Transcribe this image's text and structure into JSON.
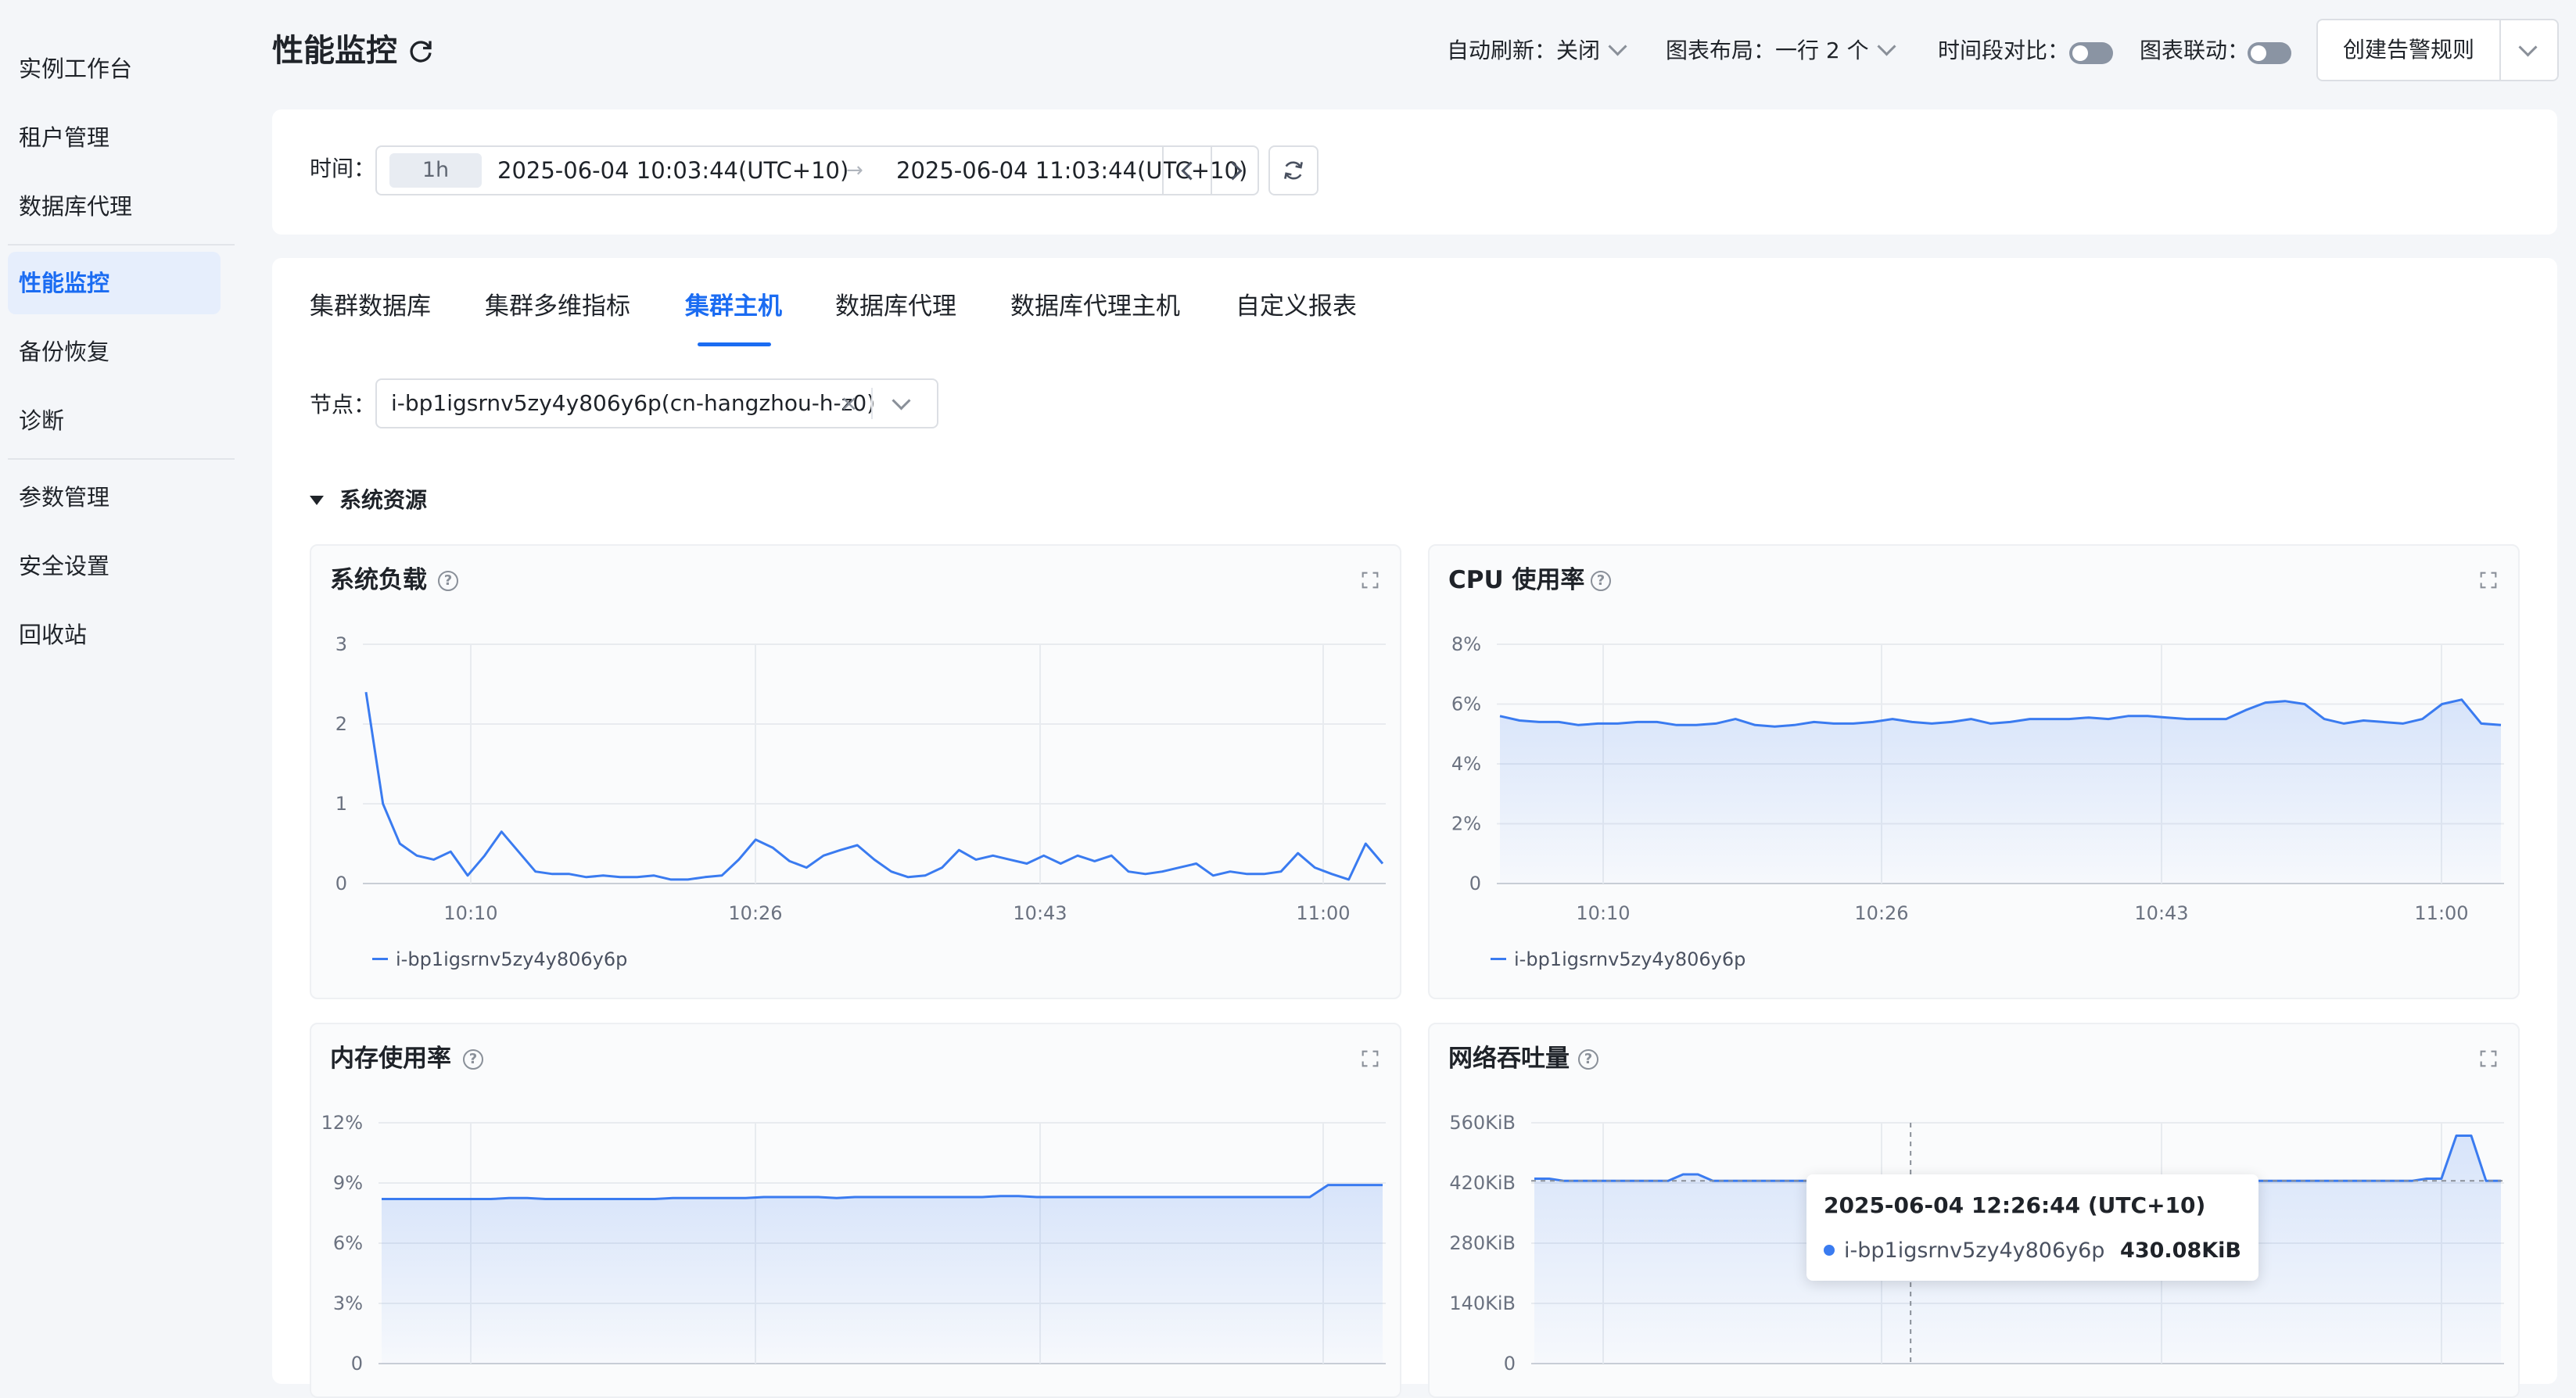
{
  "sidebar": {
    "items": [
      {
        "label": "实例工作台"
      },
      {
        "label": "租户管理"
      },
      {
        "label": "数据库代理"
      },
      {
        "label": "性能监控",
        "active": true
      },
      {
        "label": "备份恢复"
      },
      {
        "label": "诊断"
      },
      {
        "label": "参数管理"
      },
      {
        "label": "安全设置"
      },
      {
        "label": "回收站"
      }
    ]
  },
  "header": {
    "title": "性能监控",
    "auto_refresh": "自动刷新：关闭",
    "chart_layout": "图表布局：一行 2 个",
    "period_compare": "时间段对比：",
    "chart_link": "图表联动：",
    "create_alert": "创建告警规则"
  },
  "time": {
    "label": "时间：",
    "range": "1h",
    "start": "2025-06-04 10:03:44(UTC+10)",
    "arrow": "→",
    "end": "2025-06-04 11:03:44(UTC+10)"
  },
  "tabs": [
    {
      "label": "集群数据库"
    },
    {
      "label": "集群多维指标"
    },
    {
      "label": "集群主机",
      "active": true
    },
    {
      "label": "数据库代理"
    },
    {
      "label": "数据库代理主机"
    },
    {
      "label": "自定义报表"
    }
  ],
  "node": {
    "label": "节点：",
    "value": "i-bp1igsrnv5zy4y806y6p(cn-hangzhou-h-z0)",
    "remove": "×"
  },
  "section": {
    "title": "系统资源"
  },
  "colors": {
    "accent": "#1b6cf2",
    "series": "#3a7bf0"
  },
  "icons": {
    "help": "question-circle",
    "expand": "fullscreen",
    "refresh": "refresh"
  },
  "chart_data": [
    {
      "type": "line",
      "title": "系统负载",
      "help": "?",
      "yticks": [
        "3",
        "2",
        "1",
        "0"
      ],
      "ylim": [
        0,
        3
      ],
      "xticks": [
        "10:10",
        "10:26",
        "10:43",
        "11:00"
      ],
      "series": [
        {
          "name": "i-bp1igsrnv5zy4y806y6p",
          "values": [
            2.4,
            1.0,
            0.5,
            0.35,
            0.3,
            0.4,
            0.1,
            0.35,
            0.65,
            0.4,
            0.15,
            0.12,
            0.12,
            0.08,
            0.1,
            0.08,
            0.08,
            0.1,
            0.05,
            0.05,
            0.08,
            0.1,
            0.3,
            0.55,
            0.45,
            0.28,
            0.2,
            0.35,
            0.42,
            0.48,
            0.3,
            0.15,
            0.08,
            0.1,
            0.2,
            0.42,
            0.3,
            0.35,
            0.3,
            0.25,
            0.35,
            0.25,
            0.35,
            0.28,
            0.35,
            0.15,
            0.12,
            0.15,
            0.2,
            0.25,
            0.1,
            0.15,
            0.12,
            0.12,
            0.15,
            0.38,
            0.2,
            0.12,
            0.05,
            0.5,
            0.25
          ]
        }
      ],
      "legend": "i-bp1igsrnv5zy4y806y6p"
    },
    {
      "type": "area",
      "title": "CPU 使用率",
      "help": "?",
      "yticks": [
        "8%",
        "6%",
        "4%",
        "2%",
        "0"
      ],
      "ylim": [
        0,
        8
      ],
      "xticks": [
        "10:10",
        "10:26",
        "10:43",
        "11:00"
      ],
      "series": [
        {
          "name": "i-bp1igsrnv5zy4y806y6p",
          "values": [
            5.6,
            5.45,
            5.4,
            5.4,
            5.3,
            5.35,
            5.35,
            5.4,
            5.4,
            5.3,
            5.3,
            5.35,
            5.5,
            5.3,
            5.25,
            5.3,
            5.4,
            5.35,
            5.35,
            5.4,
            5.5,
            5.4,
            5.35,
            5.4,
            5.5,
            5.35,
            5.4,
            5.5,
            5.5,
            5.5,
            5.55,
            5.5,
            5.6,
            5.6,
            5.55,
            5.5,
            5.5,
            5.5,
            5.8,
            6.05,
            6.1,
            6.0,
            5.5,
            5.35,
            5.45,
            5.4,
            5.35,
            5.5,
            6.0,
            6.15,
            5.35,
            5.3
          ]
        }
      ],
      "legend": "i-bp1igsrnv5zy4y806y6p"
    },
    {
      "type": "area",
      "title": "内存使用率",
      "help": "?",
      "yticks": [
        "12%",
        "9%",
        "6%",
        "3%",
        "0"
      ],
      "ylim": [
        0,
        12
      ],
      "series": [
        {
          "name": "i-bp1igsrnv5zy4y806y6p",
          "values": [
            8.2,
            8.2,
            8.2,
            8.2,
            8.2,
            8.2,
            8.2,
            8.25,
            8.25,
            8.2,
            8.2,
            8.2,
            8.2,
            8.2,
            8.2,
            8.2,
            8.25,
            8.25,
            8.25,
            8.25,
            8.25,
            8.3,
            8.3,
            8.3,
            8.3,
            8.25,
            8.3,
            8.3,
            8.3,
            8.3,
            8.3,
            8.3,
            8.3,
            8.3,
            8.35,
            8.35,
            8.3,
            8.3,
            8.3,
            8.3,
            8.3,
            8.3,
            8.3,
            8.3,
            8.3,
            8.3,
            8.3,
            8.3,
            8.3,
            8.3,
            8.3,
            8.3,
            8.9,
            8.9,
            8.9,
            8.9
          ]
        }
      ]
    },
    {
      "type": "area",
      "title": "网络吞吐量",
      "help": "?",
      "yticks": [
        "560KiB",
        "420KiB",
        "280KiB",
        "140KiB",
        "0"
      ],
      "ylim": [
        0,
        560
      ],
      "series": [
        {
          "name": "i-bp1igsrnv5zy4y806y6p",
          "values": [
            430,
            430,
            425,
            425,
            425,
            425,
            425,
            425,
            425,
            425,
            440,
            440,
            425,
            425,
            425,
            425,
            425,
            425,
            425,
            425,
            425,
            430,
            425,
            425,
            425,
            425,
            425,
            425,
            425,
            425,
            425,
            430,
            430,
            430,
            425,
            425,
            425,
            425,
            425,
            425,
            425,
            425,
            425,
            425,
            425,
            425,
            425,
            425,
            425,
            425,
            425,
            425,
            425,
            425,
            425,
            425,
            425,
            425,
            425,
            425,
            430,
            430,
            530,
            530,
            425,
            425
          ]
        }
      ]
    }
  ],
  "tooltip": {
    "title": "2025-06-04 12:26:44 (UTC+10)",
    "name": "i-bp1igsrnv5zy4y806y6p",
    "value": "430.08KiB"
  }
}
